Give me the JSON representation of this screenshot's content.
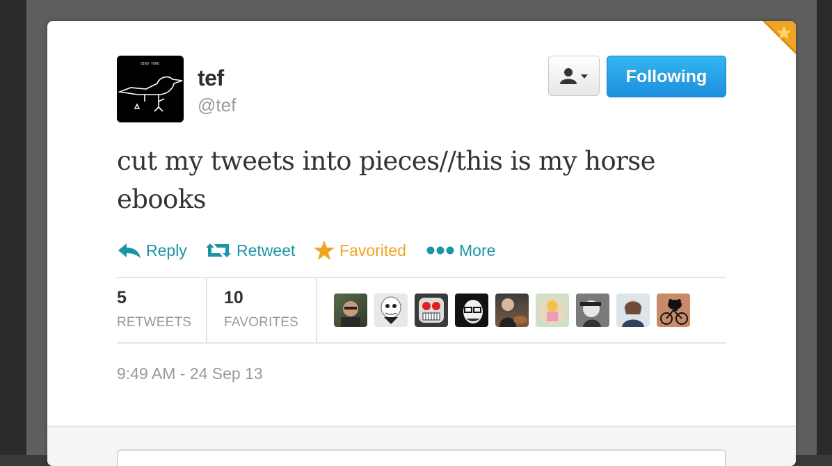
{
  "tweet": {
    "display_name": "tef",
    "screen_name": "@tef",
    "text": "cut my tweets into pieces//this is my horse ebooks",
    "timestamp": "9:49 AM - 24 Sep 13"
  },
  "avatar": {
    "caption": "BIRD TURD"
  },
  "header": {
    "user_menu_icon": "person-dropdown-icon",
    "follow_label": "Following"
  },
  "actions": {
    "reply_label": "Reply",
    "retweet_label": "Retweet",
    "favorite_label": "Favorited",
    "more_label": "More"
  },
  "stats": {
    "retweets": {
      "count": "5",
      "label": "RETWEETS"
    },
    "favorites": {
      "count": "10",
      "label": "FAVORITES"
    }
  },
  "facepile": [
    "user-avatar-1",
    "user-avatar-2",
    "user-avatar-3",
    "user-avatar-4",
    "user-avatar-5",
    "user-avatar-6",
    "user-avatar-7",
    "user-avatar-8",
    "user-avatar-9"
  ],
  "colors": {
    "link": "#1a95a8",
    "favorited": "#f0a423",
    "follow_button": "#1c8fdd"
  }
}
